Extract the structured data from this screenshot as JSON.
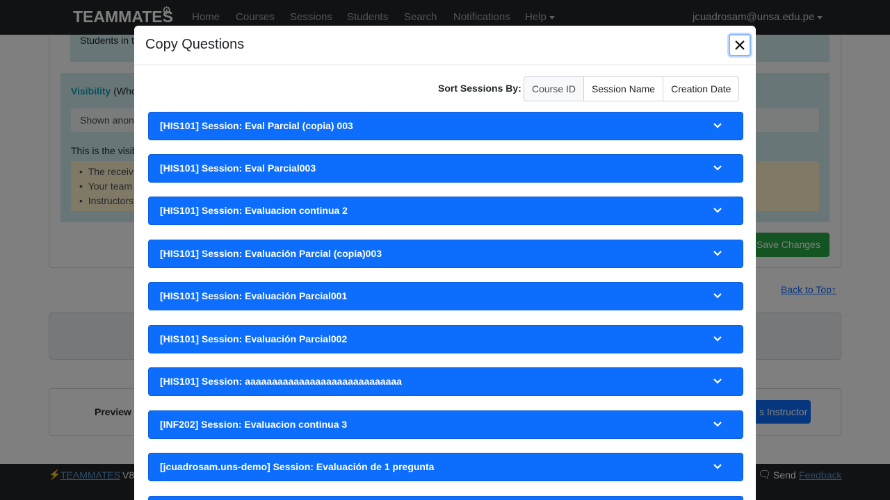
{
  "navbar": {
    "brand": "TEAMMATES",
    "items": [
      "Home",
      "Courses",
      "Sessions",
      "Students",
      "Search",
      "Notifications",
      "Help"
    ],
    "user": "jcuadrosam@unsa.edu.pe"
  },
  "background": {
    "students_text": "Students in t",
    "visibility_label": "Visibility",
    "visibility_suffix": " (Who",
    "shown_text": "Shown anon",
    "this_visibility": "This is the visib",
    "warnings": [
      "The receiv",
      "Your team",
      "Instructors"
    ],
    "save_changes": "Save Changes",
    "back_to_top": "Back to Top",
    "preview_label": "Preview",
    "instructor_button": "s Instructor"
  },
  "footer": {
    "brand": "TEAMMATES",
    "version": "V8",
    "send": "Send",
    "feedback": "Feedback"
  },
  "modal": {
    "title": "Copy Questions",
    "sort_label": "Sort Sessions By:",
    "sort_options": [
      "Course ID",
      "Session Name",
      "Creation Date"
    ],
    "sessions": [
      "[HIS101] Session: Eval Parcial (copia) 003",
      "[HIS101] Session: Eval Parcial003",
      "[HIS101] Session: Evaluacion continua 2",
      "[HIS101] Session: Evaluación Parcial (copia)003",
      "[HIS101] Session: Evaluación Parcial001",
      "[HIS101] Session: Evaluación Parcial002",
      "[HIS101] Session: aaaaaaaaaaaaaaaaaaaaaaaaaaaaa",
      "[INF202] Session: Evaluacion continua 3",
      "[jcuadrosam.uns-demo] Session: Evaluación de 1 pregunta"
    ]
  },
  "colors": {
    "navbar": "#212529",
    "session_bar": "#0d6efd",
    "accent_teal": "#17a2b8",
    "save_green": "#28a745"
  },
  "icons": {
    "close": "close-icon",
    "chevron": "chevron-down-icon",
    "back_to_top": "arrow-up-icon",
    "gear": "gear-icon",
    "bolt": "bolt-icon",
    "chat": "chat-icon"
  }
}
